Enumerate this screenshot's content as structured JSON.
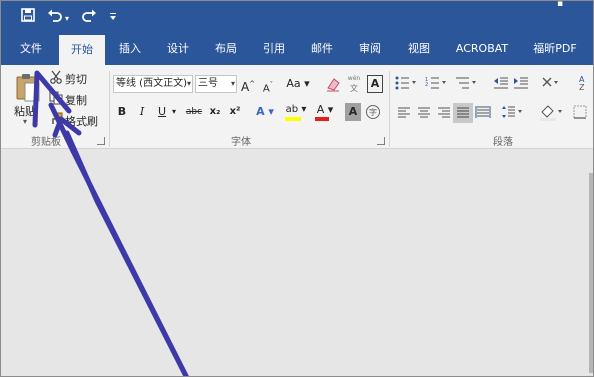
{
  "qat": {
    "save_icon": "save-icon",
    "undo_icon": "undo-icon",
    "redo_icon": "redo-icon",
    "customize_icon": "chevron-down-icon"
  },
  "tabs": [
    {
      "label": "文件"
    },
    {
      "label": "开始"
    },
    {
      "label": "插入"
    },
    {
      "label": "设计"
    },
    {
      "label": "布局"
    },
    {
      "label": "引用"
    },
    {
      "label": "邮件"
    },
    {
      "label": "审阅"
    },
    {
      "label": "视图"
    },
    {
      "label": "ACROBAT"
    },
    {
      "label": "福昕PDF"
    }
  ],
  "clipboard": {
    "paste_label": "粘贴",
    "cut_label": "剪切",
    "copy_label": "复制",
    "format_painter_label": "格式刷",
    "group_label": "剪贴板"
  },
  "font": {
    "font_name": "等线 (西文正文)",
    "font_size": "三号",
    "grow_label": "A",
    "shrink_label": "A",
    "case_label": "Aa",
    "wen_label": "文",
    "bold": "B",
    "italic": "I",
    "underline": "U",
    "strike": "abc",
    "subscript": "x₂",
    "superscript": "x²",
    "highlight_label": "ab",
    "font_color_label": "A",
    "shading_label": "A",
    "group_label": "字体",
    "highlight_color": "#ffff00",
    "font_color": "#e02020"
  },
  "paragraph": {
    "group_label": "段落"
  },
  "colors": {
    "ribbon_blue": "#2b579a",
    "arrow": "#3d3aa8"
  }
}
